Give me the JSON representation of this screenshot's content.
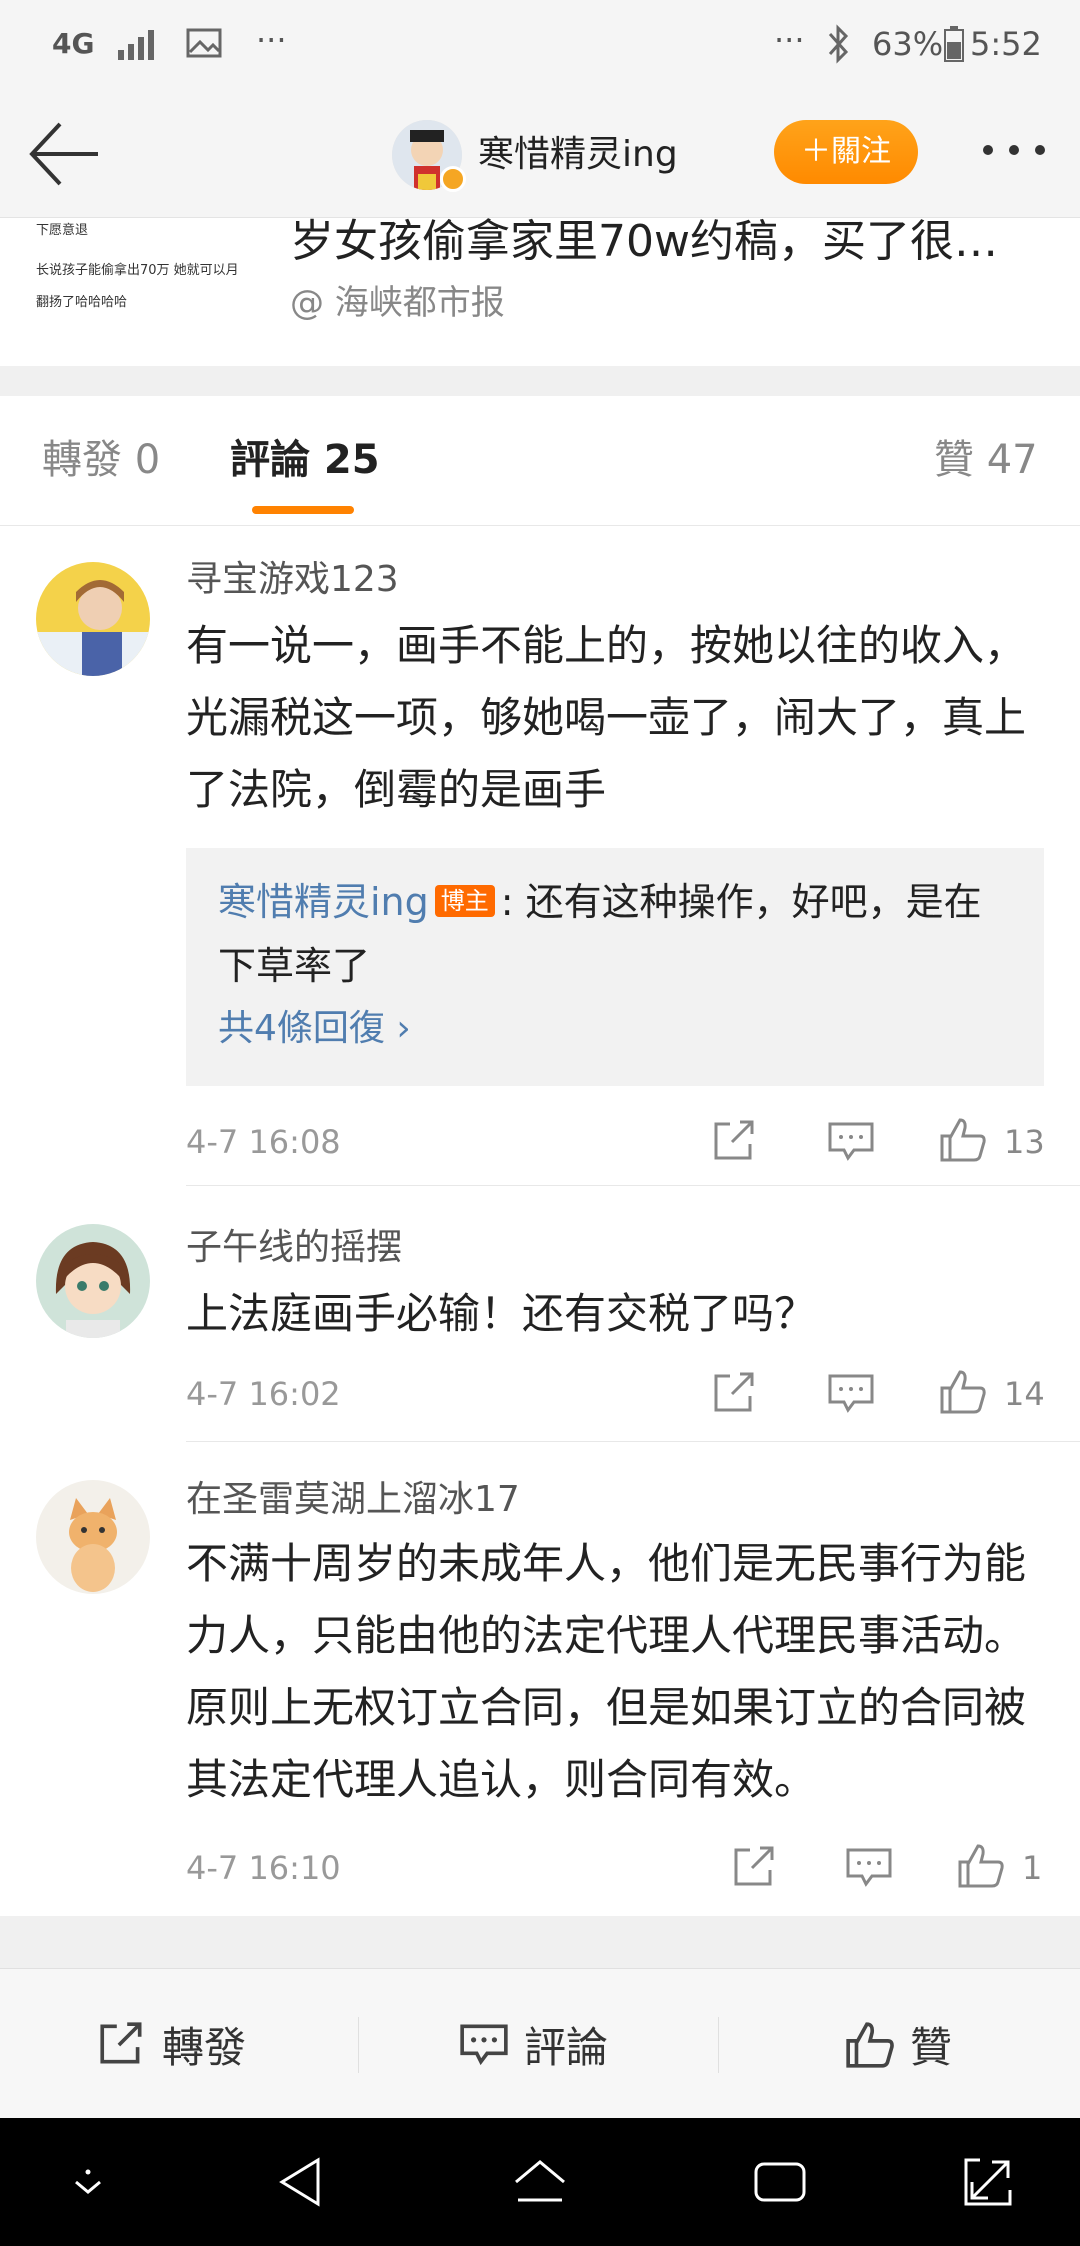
{
  "status_bar": {
    "network": "4G",
    "more": "···",
    "right_more": "···",
    "battery": "63%",
    "time": "5:52"
  },
  "header": {
    "username": "寒惜精灵ing",
    "follow_label": "＋關注"
  },
  "quoted": {
    "thumb_lines": [
      "下愿意退",
      "长说孩子能偷拿出70万 她就可以月",
      "翻扬了哈哈哈哈"
    ],
    "title": "岁女孩偷拿家里70w约稿，买了很…",
    "source": "@ 海峡都市报"
  },
  "tabs": {
    "repost": "轉發 0",
    "comments": "評論 25",
    "likes": "贊 47"
  },
  "comments": [
    {
      "user": "寻宝游戏123",
      "text": "有一说一，画手不能上的，按她以往的收入，光漏税这一项，够她喝一壶了，闹大了，真上了法院，倒霉的是画手",
      "reply": {
        "author": "寒惜精灵ing",
        "badge": "博主",
        "text": ": 还有这种操作，好吧，是在下草率了",
        "more": "共4條回復 ›"
      },
      "time": "4-7 16:08",
      "likes": "13"
    },
    {
      "user": "子午线的摇摆",
      "text": "上法庭画手必输！还有交税了吗？",
      "time": "4-7 16:02",
      "likes": "14"
    },
    {
      "user": "在圣雷莫湖上溜冰17",
      "text": "不满十周岁的未成年人，他们是无民事行为能力人，只能由他的法定代理人代理民事活动。原则上无权订立合同，但是如果订立的合同被其法定代理人追认，则合同有效。",
      "time": "4-7 16:10",
      "likes": "1"
    }
  ],
  "action_bar": {
    "repost": "轉發",
    "comment": "評論",
    "like": "贊"
  },
  "colors": {
    "accent_orange": "#ff8200",
    "link_blue": "#507daf"
  }
}
